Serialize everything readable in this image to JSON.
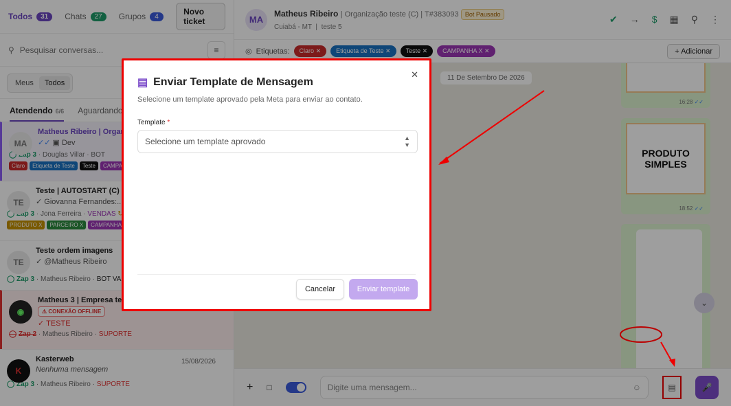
{
  "sidebar": {
    "tabs": [
      {
        "label": "Todos",
        "count": "31"
      },
      {
        "label": "Chats",
        "count": "27"
      },
      {
        "label": "Grupos",
        "count": "4"
      }
    ],
    "new_ticket": "Novo ticket",
    "search_placeholder": "Pesquisar conversas...",
    "segment": [
      "Meus",
      "Todos"
    ],
    "subtabs": [
      {
        "label": "Atendendo",
        "count": "6/6"
      },
      {
        "label": "Aguardando"
      }
    ],
    "conversations": [
      {
        "avatar": "MA",
        "name": "Matheus Ribeiro | Organi",
        "msg": "Dev",
        "channel": "Zap 3",
        "agent": "Douglas Villar",
        "queue": "BOT",
        "tags": [
          {
            "label": "Claro",
            "color": "#c92a2a"
          },
          {
            "label": "Etiqueta de Teste",
            "color": "#1971c2"
          },
          {
            "label": "Teste",
            "color": "#111111"
          },
          {
            "label": "CAMPANHA",
            "color": "#9c36b5"
          }
        ]
      },
      {
        "avatar": "TE",
        "name": "Teste | AUTOSTART (C)",
        "msg": "Giovanna Fernandes:...",
        "channel": "Zap 3",
        "agent": "Jona Ferreira",
        "queue": "VENDAS",
        "tags": [
          {
            "label": "PRODUTO X",
            "color": "#c49000"
          },
          {
            "label": "PARCEIRO X",
            "color": "#2b8a3e"
          },
          {
            "label": "CAMPANHA X",
            "color": "#9c36b5"
          }
        ]
      },
      {
        "avatar": "TE",
        "name": "Teste ordem imagens",
        "msg": "@Matheus Ribeiro",
        "channel": "Zap 3",
        "agent": "Matheus Ribeiro",
        "queue": "BOT VALUAI"
      },
      {
        "avatar": "",
        "name": "Matheus 3 | Empresa test",
        "status": "CONEXÃO OFFLINE",
        "msg": "TESTE",
        "channel": "Zap 2",
        "agent": "Matheus Ribeiro",
        "queue": "SUPORTE"
      },
      {
        "avatar": "",
        "name": "Kasterweb",
        "date": "15/08/2026",
        "msg": "Nenhuma mensagem",
        "channel": "Zap 3",
        "agent": "Matheus Ribeiro",
        "queue": "SUPORTE"
      }
    ]
  },
  "chat": {
    "avatar": "MA",
    "name": "Matheus Ribeiro",
    "org": "Organização teste (C)",
    "ticket": "T#383093",
    "bot_status": "Bot Pausado",
    "location": "Cuiabá - MT",
    "sublabel": "teste 5",
    "tags_label": "Etiquetas:",
    "tags": [
      {
        "label": "Claro",
        "color": "#c92a2a"
      },
      {
        "label": "Etiqueta de Teste",
        "color": "#1971c2"
      },
      {
        "label": "Teste",
        "color": "#111111"
      },
      {
        "label": "CAMPANHA X",
        "color": "#9c36b5"
      }
    ],
    "add_label": "Adicionar",
    "date_pill": "11 De Setembro De 2026",
    "messages": [
      {
        "time": "16:28"
      },
      {
        "text": "PRODUTO SIMPLES",
        "time": "18:52"
      }
    ],
    "composer_placeholder": "Digite uma mensagem..."
  },
  "modal": {
    "title": "Enviar Template de Mensagem",
    "description": "Selecione um template aprovado pela Meta para enviar ao contato.",
    "field_label": "Template",
    "select_placeholder": "Selecione um template aprovado",
    "cancel": "Cancelar",
    "submit": "Enviar template"
  }
}
